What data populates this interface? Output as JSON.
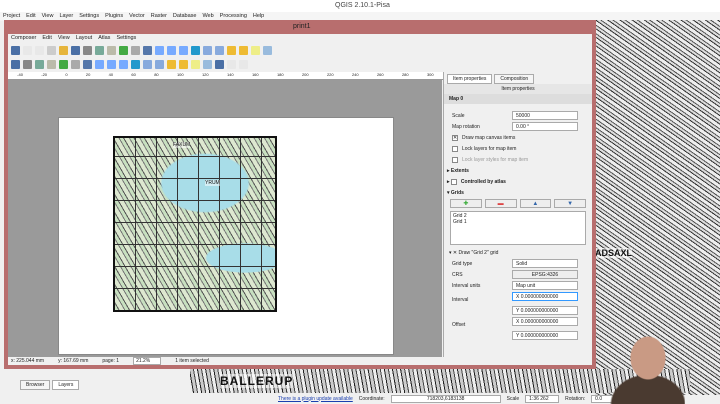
{
  "app_title": "QGIS 2.10.1-Pisa",
  "main_menu": [
    "Project",
    "Edit",
    "View",
    "Layer",
    "Settings",
    "Plugins",
    "Vector",
    "Raster",
    "Database",
    "Web",
    "Processing",
    "Help"
  ],
  "composer": {
    "title": "print1",
    "menu": [
      "Composer",
      "Edit",
      "View",
      "Layout",
      "Atlas",
      "Settings"
    ],
    "ruler_ticks": [
      "-40",
      "-20",
      "0",
      "20",
      "40",
      "60",
      "80",
      "100",
      "120",
      "140",
      "160",
      "180",
      "200",
      "220",
      "240",
      "260",
      "280",
      "300"
    ],
    "map_labels": [
      "FAXUM",
      "YRUM"
    ],
    "status": {
      "x": "x: 225.044 mm",
      "y": "y: 167.69 mm",
      "page": "page: 1",
      "zoom": "21.2%",
      "selection": "1 item selected"
    }
  },
  "panel": {
    "tabs": [
      "Item properties",
      "Composition"
    ],
    "header": "Item properties",
    "section": "Map 0",
    "scale_label": "Scale",
    "scale_value": "50000",
    "rotation_label": "Map rotation",
    "rotation_value": "0.00 °",
    "draw_canvas": "Draw map canvas items",
    "lock_layers": "Lock layers for map item",
    "lock_styles": "Lock layer styles for map item",
    "extents": "Extents",
    "atlas": "Controlled by atlas",
    "grids": "Grids",
    "grid_list": [
      "Grid 2",
      "Grid 1"
    ],
    "draw_grid": "Draw \"Grid 2\" grid",
    "grid_type_label": "Grid type",
    "grid_type": "Solid",
    "crs_label": "CRS",
    "crs": "EPSG:4326",
    "interval_units_label": "Interval units",
    "interval_units": "Map unit",
    "interval_label": "Interval",
    "interval_x": "X 0.000000000000",
    "interval_y": "Y 0.000000000000",
    "offset_label": "Offset",
    "offset_x": "X 0.000000000000",
    "offset_y": "Y 0.000000000000"
  },
  "bg_map_labels": [
    "ADSAXL",
    "BALLERUP"
  ],
  "layer_tabs": [
    "Browser",
    "Layers"
  ],
  "main_status": {
    "plugin_update": "There is a plugin update available",
    "coordinate_label": "Coordinate:",
    "coordinate": "718203,6183138",
    "scale_label": "Scale",
    "scale": "1:36 262",
    "rotation_label": "Rotation:",
    "rotation": "0.0"
  }
}
